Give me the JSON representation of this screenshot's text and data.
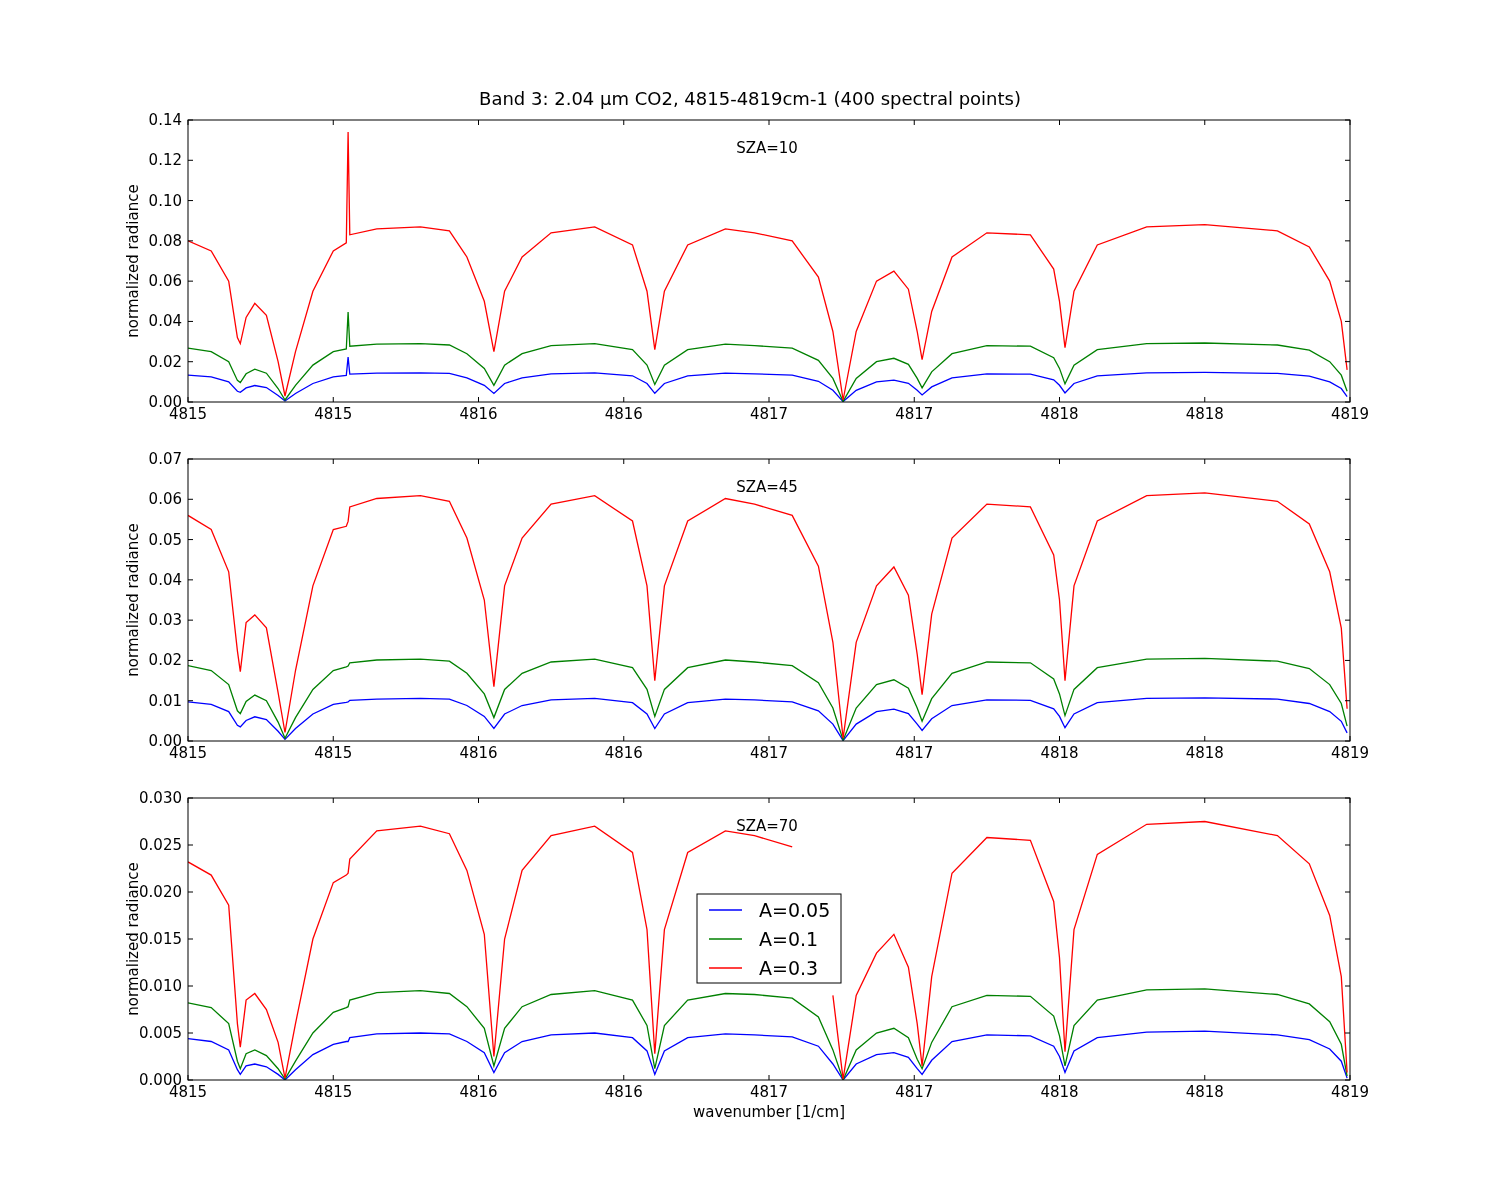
{
  "title": "Band 3: 2.04 μm CO2, 4815-4819cm-1 (400 spectral points)",
  "panels": [
    {
      "chart_data": {
        "type": "line",
        "ylabel": "normalized radiance",
        "xlim": [
          4815,
          4819
        ],
        "ylim": [
          0,
          0.14
        ],
        "xticks": [
          {
            "value": 4815,
            "label": "4815"
          },
          {
            "value": 4815.5,
            "label": "4815"
          },
          {
            "value": 4816,
            "label": "4816"
          },
          {
            "value": 4816.5,
            "label": "4816"
          },
          {
            "value": 4817,
            "label": "4817"
          },
          {
            "value": 4817.5,
            "label": "4817"
          },
          {
            "value": 4818,
            "label": "4818"
          },
          {
            "value": 4818.5,
            "label": "4818"
          },
          {
            "value": 4819,
            "label": "4819"
          }
        ],
        "yticks": [
          {
            "value": 0,
            "label": "0.00"
          },
          {
            "value": 0.02,
            "label": "0.02"
          },
          {
            "value": 0.04,
            "label": "0.04"
          },
          {
            "value": 0.06,
            "label": "0.06"
          },
          {
            "value": 0.08,
            "label": "0.08"
          },
          {
            "value": 0.1,
            "label": "0.10"
          },
          {
            "value": 0.12,
            "label": "0.12"
          },
          {
            "value": 0.14,
            "label": "0.14"
          }
        ],
        "annotations": [
          {
            "text": "SZA=10"
          }
        ],
        "x": [
          4815.0,
          4815.08,
          4815.14,
          4815.17,
          4815.18,
          4815.2,
          4815.23,
          4815.27,
          4815.31,
          4815.334,
          4815.37,
          4815.43,
          4815.5,
          4815.545,
          4815.551,
          4815.557,
          4815.65,
          4815.8,
          4815.9,
          4815.96,
          4816.02,
          4816.053,
          4816.09,
          4816.15,
          4816.25,
          4816.4,
          4816.53,
          4816.58,
          4816.607,
          4816.64,
          4816.72,
          4816.85,
          4816.95,
          4817.08,
          4817.17,
          4817.22,
          4817.255,
          4817.3,
          4817.37,
          4817.43,
          4817.48,
          4817.51,
          4817.527,
          4817.56,
          4817.63,
          4817.75,
          4817.9,
          4817.98,
          4818.0,
          4818.019,
          4818.05,
          4818.13,
          4818.3,
          4818.5,
          4818.75,
          4818.86,
          4818.93,
          4818.97,
          4818.99
        ],
        "series": [
          {
            "color": "#0000ff",
            "values": [
              0.0133,
              0.0125,
              0.01,
              0.0053,
              0.0048,
              0.007,
              0.0082,
              0.0072,
              0.0033,
              0.0005,
              0.0042,
              0.0092,
              0.0125,
              0.0132,
              0.0223,
              0.0138,
              0.0143,
              0.0145,
              0.0142,
              0.012,
              0.0083,
              0.0042,
              0.0092,
              0.012,
              0.014,
              0.0145,
              0.013,
              0.0092,
              0.0043,
              0.0092,
              0.013,
              0.0143,
              0.014,
              0.0133,
              0.0103,
              0.0058,
              0.0002,
              0.0058,
              0.01,
              0.0108,
              0.0093,
              0.0058,
              0.0035,
              0.0075,
              0.012,
              0.014,
              0.0138,
              0.011,
              0.0083,
              0.0045,
              0.0092,
              0.013,
              0.0145,
              0.0147,
              0.0142,
              0.0128,
              0.01,
              0.0067,
              0.0027
            ]
          },
          {
            "color": "#008000",
            "values": [
              0.0267,
              0.025,
              0.02,
              0.0107,
              0.0097,
              0.014,
              0.0163,
              0.0143,
              0.0067,
              0.001,
              0.0083,
              0.0183,
              0.025,
              0.0263,
              0.0447,
              0.0277,
              0.0287,
              0.029,
              0.0283,
              0.024,
              0.0167,
              0.0083,
              0.0183,
              0.024,
              0.028,
              0.029,
              0.026,
              0.0183,
              0.0087,
              0.0183,
              0.026,
              0.0287,
              0.028,
              0.0267,
              0.0207,
              0.0117,
              0.0003,
              0.0117,
              0.02,
              0.0217,
              0.0187,
              0.0117,
              0.007,
              0.015,
              0.024,
              0.028,
              0.0277,
              0.022,
              0.0167,
              0.009,
              0.0183,
              0.026,
              0.029,
              0.0293,
              0.0283,
              0.0257,
              0.02,
              0.0133,
              0.0053
            ]
          },
          {
            "color": "#ff0000",
            "values": [
              0.08,
              0.075,
              0.06,
              0.032,
              0.029,
              0.042,
              0.049,
              0.043,
              0.02,
              0.003,
              0.025,
              0.055,
              0.075,
              0.079,
              0.134,
              0.083,
              0.086,
              0.087,
              0.085,
              0.072,
              0.05,
              0.025,
              0.055,
              0.072,
              0.084,
              0.087,
              0.078,
              0.055,
              0.026,
              0.055,
              0.078,
              0.086,
              0.084,
              0.08,
              0.062,
              0.035,
              0.001,
              0.035,
              0.06,
              0.065,
              0.056,
              0.035,
              0.021,
              0.045,
              0.072,
              0.084,
              0.083,
              0.066,
              0.05,
              0.027,
              0.055,
              0.078,
              0.087,
              0.088,
              0.085,
              0.077,
              0.06,
              0.04,
              0.016
            ]
          }
        ]
      }
    },
    {
      "chart_data": {
        "type": "line",
        "ylabel": "normalized radiance",
        "xlim": [
          4815,
          4819
        ],
        "ylim": [
          0,
          0.07
        ],
        "xticks": [
          {
            "value": 4815,
            "label": "4815"
          },
          {
            "value": 4815.5,
            "label": "4815"
          },
          {
            "value": 4816,
            "label": "4816"
          },
          {
            "value": 4816.5,
            "label": "4816"
          },
          {
            "value": 4817,
            "label": "4817"
          },
          {
            "value": 4817.5,
            "label": "4817"
          },
          {
            "value": 4818,
            "label": "4818"
          },
          {
            "value": 4818.5,
            "label": "4818"
          },
          {
            "value": 4819,
            "label": "4819"
          }
        ],
        "yticks": [
          {
            "value": 0,
            "label": "0.00"
          },
          {
            "value": 0.01,
            "label": "0.01"
          },
          {
            "value": 0.02,
            "label": "0.02"
          },
          {
            "value": 0.03,
            "label": "0.03"
          },
          {
            "value": 0.04,
            "label": "0.04"
          },
          {
            "value": 0.05,
            "label": "0.05"
          },
          {
            "value": 0.06,
            "label": "0.06"
          },
          {
            "value": 0.07,
            "label": "0.07"
          }
        ],
        "annotations": [
          {
            "text": "SZA=45"
          }
        ],
        "x": [
          4815.0,
          4815.08,
          4815.14,
          4815.17,
          4815.18,
          4815.2,
          4815.23,
          4815.27,
          4815.31,
          4815.334,
          4815.37,
          4815.43,
          4815.5,
          4815.545,
          4815.551,
          4815.557,
          4815.65,
          4815.8,
          4815.9,
          4815.96,
          4816.02,
          4816.053,
          4816.09,
          4816.15,
          4816.25,
          4816.4,
          4816.53,
          4816.58,
          4816.607,
          4816.64,
          4816.72,
          4816.85,
          4816.95,
          4817.08,
          4817.17,
          4817.22,
          4817.255,
          4817.3,
          4817.37,
          4817.43,
          4817.48,
          4817.51,
          4817.527,
          4817.56,
          4817.63,
          4817.75,
          4817.9,
          4817.98,
          4818.0,
          4818.019,
          4818.05,
          4818.13,
          4818.3,
          4818.5,
          4818.75,
          4818.86,
          4818.93,
          4818.97,
          4818.99
        ],
        "series": [
          {
            "color": "#0000ff",
            "values": [
              0.0097,
              0.0091,
              0.0073,
              0.0039,
              0.0035,
              0.0051,
              0.006,
              0.0053,
              0.0024,
              0.0004,
              0.0031,
              0.0067,
              0.0091,
              0.0096,
              0.0097,
              0.0101,
              0.0104,
              0.0106,
              0.0104,
              0.0088,
              0.0061,
              0.0031,
              0.0067,
              0.0088,
              0.0102,
              0.0106,
              0.0095,
              0.0067,
              0.0031,
              0.0067,
              0.0095,
              0.0104,
              0.0102,
              0.0097,
              0.0075,
              0.0042,
              0.0001,
              0.0042,
              0.0073,
              0.0079,
              0.0068,
              0.0042,
              0.0026,
              0.0055,
              0.0088,
              0.0102,
              0.0101,
              0.008,
              0.0061,
              0.0033,
              0.0067,
              0.0095,
              0.0106,
              0.0107,
              0.0104,
              0.0093,
              0.0073,
              0.0049,
              0.002
            ]
          },
          {
            "color": "#008000",
            "values": [
              0.0187,
              0.0175,
              0.014,
              0.0075,
              0.0068,
              0.0098,
              0.0114,
              0.01,
              0.0047,
              0.0007,
              0.0058,
              0.0128,
              0.0175,
              0.0184,
              0.0186,
              0.0194,
              0.0201,
              0.0203,
              0.0198,
              0.0168,
              0.0117,
              0.0058,
              0.0128,
              0.0168,
              0.0196,
              0.0203,
              0.0182,
              0.0128,
              0.0061,
              0.0128,
              0.0182,
              0.0201,
              0.0196,
              0.0187,
              0.0145,
              0.0082,
              0.0002,
              0.0082,
              0.014,
              0.0152,
              0.0131,
              0.0082,
              0.0049,
              0.0105,
              0.0168,
              0.0196,
              0.0194,
              0.0154,
              0.0117,
              0.0063,
              0.0128,
              0.0182,
              0.0203,
              0.0205,
              0.0198,
              0.018,
              0.014,
              0.0093,
              0.0037
            ]
          },
          {
            "color": "#ff0000",
            "values": [
              0.056,
              0.0525,
              0.042,
              0.0224,
              0.0172,
              0.0294,
              0.0313,
              0.0281,
              0.012,
              0.0021,
              0.0175,
              0.0385,
              0.0525,
              0.0533,
              0.0545,
              0.0581,
              0.0602,
              0.0609,
              0.0595,
              0.0504,
              0.035,
              0.0135,
              0.0385,
              0.0504,
              0.0588,
              0.0609,
              0.0546,
              0.0385,
              0.015,
              0.0385,
              0.0546,
              0.0602,
              0.0588,
              0.056,
              0.0434,
              0.0245,
              0.0007,
              0.0245,
              0.0385,
              0.0432,
              0.0362,
              0.0215,
              0.0115,
              0.0315,
              0.0504,
              0.0588,
              0.0581,
              0.0462,
              0.035,
              0.015,
              0.0385,
              0.0546,
              0.0609,
              0.0616,
              0.0595,
              0.0539,
              0.042,
              0.028,
              0.008
            ]
          }
        ]
      }
    },
    {
      "chart_data": {
        "type": "line",
        "legend": true,
        "xlabel": "wavenumber [1/cm]",
        "ylabel": "normalized radiance",
        "xlim": [
          4815,
          4819
        ],
        "ylim": [
          0,
          0.03
        ],
        "xticks": [
          {
            "value": 4815,
            "label": "4815"
          },
          {
            "value": 4815.5,
            "label": "4815"
          },
          {
            "value": 4816,
            "label": "4816"
          },
          {
            "value": 4816.5,
            "label": "4816"
          },
          {
            "value": 4817,
            "label": "4817"
          },
          {
            "value": 4817.5,
            "label": "4817"
          },
          {
            "value": 4818,
            "label": "4818"
          },
          {
            "value": 4818.5,
            "label": "4818"
          },
          {
            "value": 4819,
            "label": "4819"
          }
        ],
        "yticks": [
          {
            "value": 0,
            "label": "0.000"
          },
          {
            "value": 0.005,
            "label": "0.005"
          },
          {
            "value": 0.01,
            "label": "0.010"
          },
          {
            "value": 0.015,
            "label": "0.015"
          },
          {
            "value": 0.02,
            "label": "0.020"
          },
          {
            "value": 0.025,
            "label": "0.025"
          },
          {
            "value": 0.03,
            "label": "0.030"
          }
        ],
        "annotations": [
          {
            "text": "SZA=70"
          }
        ],
        "x": [
          4815.0,
          4815.08,
          4815.14,
          4815.17,
          4815.18,
          4815.2,
          4815.23,
          4815.27,
          4815.31,
          4815.334,
          4815.37,
          4815.43,
          4815.5,
          4815.545,
          4815.551,
          4815.557,
          4815.65,
          4815.8,
          4815.9,
          4815.96,
          4816.02,
          4816.053,
          4816.09,
          4816.15,
          4816.25,
          4816.4,
          4816.53,
          4816.58,
          4816.607,
          4816.64,
          4816.72,
          4816.85,
          4816.95,
          4817.08,
          4817.17,
          4817.22,
          4817.255,
          4817.3,
          4817.37,
          4817.43,
          4817.48,
          4817.51,
          4817.527,
          4817.56,
          4817.63,
          4817.75,
          4817.9,
          4817.98,
          4818.0,
          4818.019,
          4818.05,
          4818.13,
          4818.3,
          4818.5,
          4818.75,
          4818.86,
          4818.93,
          4818.97,
          4818.99
        ],
        "series": [
          {
            "name": "A=0.05",
            "color": "#0000ff",
            "values": [
              0.0044,
              0.0041,
              0.0032,
              0.0011,
              0.0006,
              0.0015,
              0.0017,
              0.0014,
              0.0006,
              0,
              0.0011,
              0.0027,
              0.0038,
              0.0041,
              0.0041,
              0.0045,
              0.0049,
              0.005,
              0.0049,
              0.0041,
              0.0029,
              0.0008,
              0.0029,
              0.0041,
              0.0048,
              0.005,
              0.0045,
              0.0031,
              0.0006,
              0.0031,
              0.0045,
              0.0049,
              0.0048,
              0.0046,
              0.0036,
              0.0017,
              0,
              0.0017,
              0.0027,
              0.0029,
              0.0024,
              0.0012,
              0.0006,
              0.0021,
              0.0041,
              0.0048,
              0.0047,
              0.0036,
              0.0025,
              0.0008,
              0.0031,
              0.0045,
              0.0051,
              0.0052,
              0.0048,
              0.0043,
              0.0033,
              0.002,
              0.0002
            ]
          },
          {
            "name": "A=0.1",
            "color": "#008000",
            "values": [
              0.0082,
              0.0077,
              0.006,
              0.002,
              0.0012,
              0.0028,
              0.0032,
              0.0026,
              0.0012,
              0.0001,
              0.002,
              0.005,
              0.0072,
              0.0077,
              0.0078,
              0.0085,
              0.0093,
              0.0095,
              0.0092,
              0.0078,
              0.0055,
              0.0015,
              0.0055,
              0.0078,
              0.0091,
              0.0095,
              0.0085,
              0.0058,
              0.0012,
              0.0058,
              0.0085,
              0.0092,
              0.0091,
              0.0087,
              0.0067,
              0.0032,
              0,
              0.0032,
              0.005,
              0.0055,
              0.0045,
              0.0022,
              0.0012,
              0.004,
              0.0078,
              0.009,
              0.0089,
              0.0068,
              0.0047,
              0.0015,
              0.0058,
              0.0085,
              0.0096,
              0.0097,
              0.0091,
              0.0081,
              0.0062,
              0.0038,
              0.0004
            ]
          },
          {
            "name": "A=0.3",
            "color": "#ff0000",
            "values": [
              0.0232,
              0.0218,
              0.0186,
              0.006,
              0.0035,
              0.0085,
              0.0092,
              0.0075,
              0.004,
              0.0002,
              0.006,
              0.015,
              0.021,
              0.0218,
              0.022,
              0.0235,
              0.0265,
              0.027,
              0.0262,
              0.0223,
              0.0155,
              0.0025,
              0.015,
              0.0223,
              0.026,
              0.027,
              0.0242,
              0.016,
              0.0028,
              0.016,
              0.0242,
              0.0265,
              0.026,
              0.0248,
              null,
              0.009,
              0.0001,
              0.009,
              0.0135,
              0.0155,
              0.012,
              0.006,
              0.0015,
              0.011,
              0.022,
              0.0258,
              0.0255,
              0.019,
              0.013,
              0.003,
              0.016,
              0.024,
              0.0272,
              0.0275,
              0.026,
              0.023,
              0.0175,
              0.011,
              0.0008
            ]
          }
        ]
      }
    }
  ]
}
